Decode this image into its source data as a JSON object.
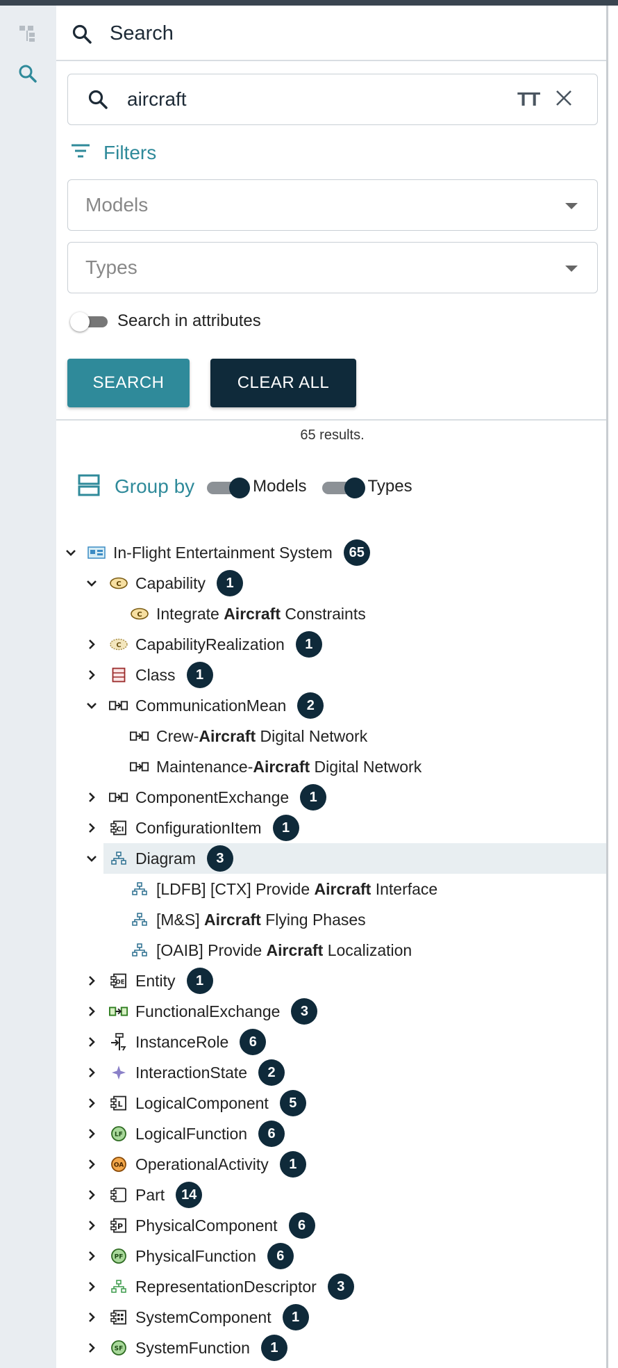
{
  "search_panel": {
    "title": "Search",
    "query": "aircraft",
    "case_toggle_label": "TT",
    "filters_label": "Filters",
    "models_placeholder": "Models",
    "types_placeholder": "Types",
    "search_in_attributes": "Search in attributes",
    "search_button": "SEARCH",
    "clear_all_button": "CLEAR ALL",
    "results": "65 results."
  },
  "group_by": {
    "label": "Group by",
    "models": "Models",
    "types": "Types"
  },
  "tree": {
    "root": {
      "label": "In-Flight Entertainment System",
      "count": "65"
    },
    "groups": [
      {
        "label": "Capability",
        "count": "1",
        "icon": "capability-icon",
        "children": [
          {
            "pre": "Integrate ",
            "hl": "Aircraft",
            "post": " Constraints"
          }
        ]
      },
      {
        "label": "CapabilityRealization",
        "count": "1",
        "icon": "capability-realization-icon"
      },
      {
        "label": "Class",
        "count": "1",
        "icon": "class-icon"
      },
      {
        "label": "CommunicationMean",
        "count": "2",
        "icon": "communication-mean-icon",
        "children": [
          {
            "pre": "Crew-",
            "hl": "Aircraft",
            "post": " Digital Network"
          },
          {
            "pre": "Maintenance-",
            "hl": "Aircraft",
            "post": " Digital Network"
          }
        ]
      },
      {
        "label": "ComponentExchange",
        "count": "1",
        "icon": "component-exchange-icon"
      },
      {
        "label": "ConfigurationItem",
        "count": "1",
        "icon": "configuration-item-icon"
      },
      {
        "label": "Diagram",
        "count": "3",
        "icon": "diagram-icon",
        "children": [
          {
            "pre": "[LDFB] [CTX] Provide ",
            "hl": "Aircraft",
            "post": " Interface"
          },
          {
            "pre": "[M&S] ",
            "hl": "Aircraft",
            "post": " Flying Phases"
          },
          {
            "pre": "[OAIB] Provide ",
            "hl": "Aircraft",
            "post": " Localization"
          }
        ]
      },
      {
        "label": "Entity",
        "count": "1",
        "icon": "entity-icon"
      },
      {
        "label": "FunctionalExchange",
        "count": "3",
        "icon": "functional-exchange-icon"
      },
      {
        "label": "InstanceRole",
        "count": "6",
        "icon": "instance-role-icon"
      },
      {
        "label": "InteractionState",
        "count": "2",
        "icon": "interaction-state-icon"
      },
      {
        "label": "LogicalComponent",
        "count": "5",
        "icon": "logical-component-icon"
      },
      {
        "label": "LogicalFunction",
        "count": "6",
        "icon": "logical-function-icon"
      },
      {
        "label": "OperationalActivity",
        "count": "1",
        "icon": "operational-activity-icon"
      },
      {
        "label": "Part",
        "count": "14",
        "icon": "part-icon"
      },
      {
        "label": "PhysicalComponent",
        "count": "6",
        "icon": "physical-component-icon"
      },
      {
        "label": "PhysicalFunction",
        "count": "6",
        "icon": "physical-function-icon"
      },
      {
        "label": "RepresentationDescriptor",
        "count": "3",
        "icon": "representation-descriptor-icon"
      },
      {
        "label": "SystemComponent",
        "count": "1",
        "icon": "system-component-icon"
      },
      {
        "label": "SystemFunction",
        "count": "1",
        "icon": "system-function-icon"
      }
    ]
  },
  "colors": {
    "accent": "#2f8a9a",
    "dark": "#0f2a3a",
    "selected_row": "#e8eef1"
  }
}
